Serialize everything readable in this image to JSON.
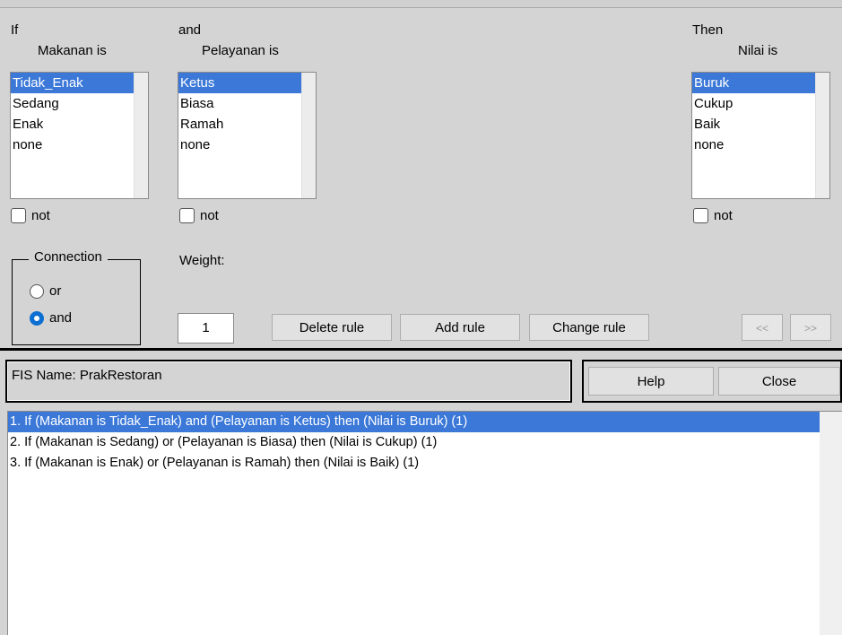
{
  "if_col": {
    "header": "If",
    "var_label": "Makanan is",
    "items": [
      "Tidak_Enak",
      "Sedang",
      "Enak",
      "none"
    ],
    "selected_index": 0,
    "not_label": "not"
  },
  "and_col": {
    "header": "and",
    "var_label": "Pelayanan is",
    "items": [
      "Ketus",
      "Biasa",
      "Ramah",
      "none"
    ],
    "selected_index": 0,
    "not_label": "not"
  },
  "then_col": {
    "header": "Then",
    "var_label": "Nilai is",
    "items": [
      "Buruk",
      "Cukup",
      "Baik",
      "none"
    ],
    "selected_index": 0,
    "not_label": "not"
  },
  "connection": {
    "title": "Connection",
    "options": [
      "or",
      "and"
    ],
    "selected": "and"
  },
  "weight": {
    "label": "Weight:",
    "value": "1"
  },
  "buttons": {
    "delete": "Delete rule",
    "add": "Add rule",
    "change": "Change rule",
    "prev": "<<",
    "next": ">>"
  },
  "status": {
    "fis_name": "FIS Name: PrakRestoran"
  },
  "footer_buttons": {
    "help": "Help",
    "close": "Close"
  },
  "rules": [
    "1. If (Makanan is Tidak_Enak) and (Pelayanan is Ketus) then (Nilai is Buruk) (1)",
    "2. If (Makanan is Sedang) or (Pelayanan is Biasa) then (Nilai is Cukup) (1)",
    "3. If (Makanan is Enak) or (Pelayanan is Ramah) then (Nilai is Baik) (1)"
  ],
  "selected_rule_index": 0
}
